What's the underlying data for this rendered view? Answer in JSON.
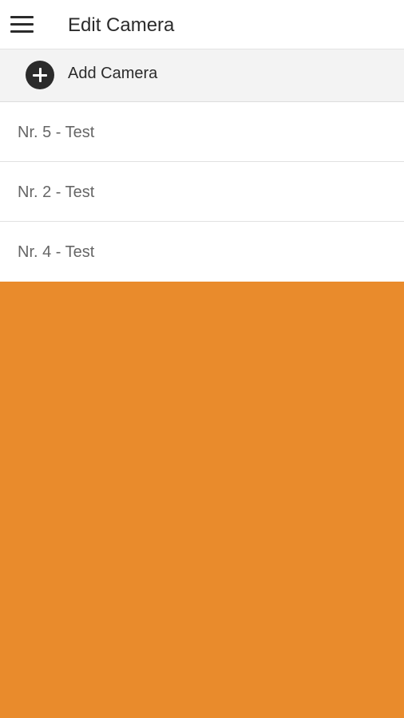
{
  "header": {
    "title": "Edit Camera",
    "menu_icon": "hamburger-menu-icon"
  },
  "add_camera": {
    "label": "Add Camera",
    "icon": "plus-circle-icon"
  },
  "cameras": [
    {
      "label": "Nr. 5 - Test"
    },
    {
      "label": "Nr. 2 - Test"
    },
    {
      "label": "Nr. 4 - Test"
    }
  ],
  "colors": {
    "background": "#e98b2c",
    "surface": "#ffffff",
    "add_row_bg": "#f3f3f3",
    "text_primary": "#2b2b2b",
    "text_secondary": "#666666"
  }
}
